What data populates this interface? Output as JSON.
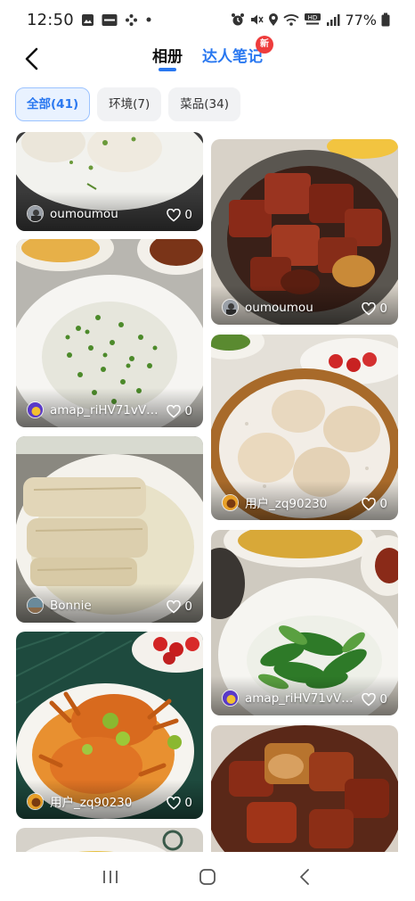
{
  "status_bar": {
    "time": "12:50",
    "battery": "77%",
    "left_icons": [
      "gallery-icon",
      "kbook-icon",
      "pinwheel-icon",
      "dot-icon"
    ],
    "right_icons": [
      "alarm-icon",
      "mute-icon",
      "location-icon",
      "wifi-icon",
      "hd-voice-icon",
      "signal-icon",
      "battery-icon"
    ]
  },
  "header": {
    "tab_album": "相册",
    "tab_notes": "达人笔记",
    "new_badge": "新"
  },
  "filters": [
    {
      "label": "全部(41)",
      "active": true
    },
    {
      "label": "环境(7)",
      "active": false
    },
    {
      "label": "菜品(34)",
      "active": false
    }
  ],
  "posts": [
    {
      "author": "oumoumou",
      "likes": "0",
      "photo": "steamed-buns"
    },
    {
      "author": "oumoumou",
      "likes": "0",
      "photo": "braised-pork"
    },
    {
      "author": "amap_riHV71vV…",
      "likes": "0",
      "photo": "vegetable-fried-rice"
    },
    {
      "author": "用户_zq90230",
      "likes": "0",
      "photo": "soup-dumplings"
    },
    {
      "author": "Bonnie",
      "likes": "0",
      "photo": "tofu-skin-rolls"
    },
    {
      "author": "amap_riHV71vV…",
      "likes": "0",
      "photo": "stir-fried-greens"
    },
    {
      "author": "用户_zq90230",
      "likes": "0",
      "photo": "hairy-crabs"
    },
    {
      "author": "",
      "likes": "",
      "photo": "braised-meat-partial"
    },
    {
      "author": "",
      "likes": "",
      "photo": "plate-partial"
    }
  ]
}
